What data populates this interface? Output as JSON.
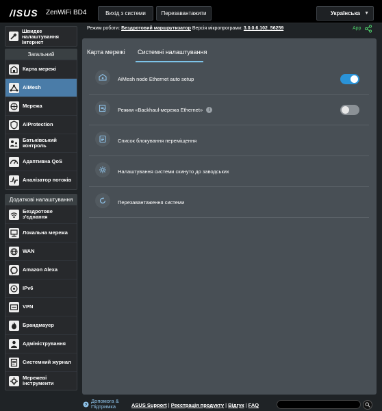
{
  "header": {
    "logo": "/ISUS",
    "model": "ZenWiFi BD4",
    "logout_label": "Вихід з системи",
    "reboot_label": "Перезавантажити",
    "language": "Українська"
  },
  "status": {
    "mode_label": "Режим роботи:",
    "mode_value": "Бездротовий маршрутизатор",
    "firmware_label": "Версія мікропрограми:",
    "firmware_value": "3.0.0.6.102_56259",
    "app_label": "App"
  },
  "sidebar": {
    "quick_setup": "Швидке налаштування Інтернет",
    "general_title": "Загальний",
    "general_items": [
      {
        "label": "Карта мережі",
        "icon": "network-map-icon"
      },
      {
        "label": "AiMesh",
        "icon": "aimesh-icon"
      },
      {
        "label": "Мережа",
        "icon": "network-icon"
      },
      {
        "label": "AiProtection",
        "icon": "aiprotection-icon"
      },
      {
        "label": "Батьківський контроль",
        "icon": "parental-control-icon"
      },
      {
        "label": "Адаптивна QoS",
        "icon": "adaptive-qos-icon"
      },
      {
        "label": "Аналізатор потоків",
        "icon": "traffic-analyzer-icon"
      }
    ],
    "advanced_title": "Додаткові налаштування",
    "advanced_items": [
      {
        "label": "Бездротове з'єднання",
        "icon": "wireless-icon"
      },
      {
        "label": "Локальна мережа",
        "icon": "lan-icon"
      },
      {
        "label": "WAN",
        "icon": "wan-icon"
      },
      {
        "label": "Amazon Alexa",
        "icon": "alexa-icon"
      },
      {
        "label": "IPv6",
        "icon": "ipv6-icon"
      },
      {
        "label": "VPN",
        "icon": "vpn-icon"
      },
      {
        "label": "Брандмауер",
        "icon": "firewall-icon"
      },
      {
        "label": "Адміністрування",
        "icon": "administration-icon"
      },
      {
        "label": "Системний журнал",
        "icon": "system-log-icon"
      },
      {
        "label": "Мережеві інструменти",
        "icon": "network-tools-icon"
      }
    ],
    "active_item": "AiMesh"
  },
  "main": {
    "tabs": [
      "Карта мережі",
      "Системні налаштування"
    ],
    "active_tab": "Системні налаштування",
    "rows": [
      {
        "label": "AiMesh node Ethernet auto setup",
        "toggle": true
      },
      {
        "label": "Режим «Backhaul-мережа Ethernet»",
        "toggle": false,
        "info": "i"
      },
      {
        "label": "Список блокування переміщення"
      },
      {
        "label": "Налаштування системи скинуто до заводських"
      },
      {
        "label": "Перезавантаження системи"
      }
    ]
  },
  "footer": {
    "help": "Допомога & Підтримка",
    "asus_support": "ASUS Support",
    "register": "Реєстрація продукту",
    "feedback": "Відгук",
    "faq": "FAQ",
    "separator": " | ",
    "search_value": ""
  },
  "colors": {
    "accent": "#2a93d8",
    "active_nav": "#4a7ca8",
    "app_green": "#4fd26c"
  }
}
